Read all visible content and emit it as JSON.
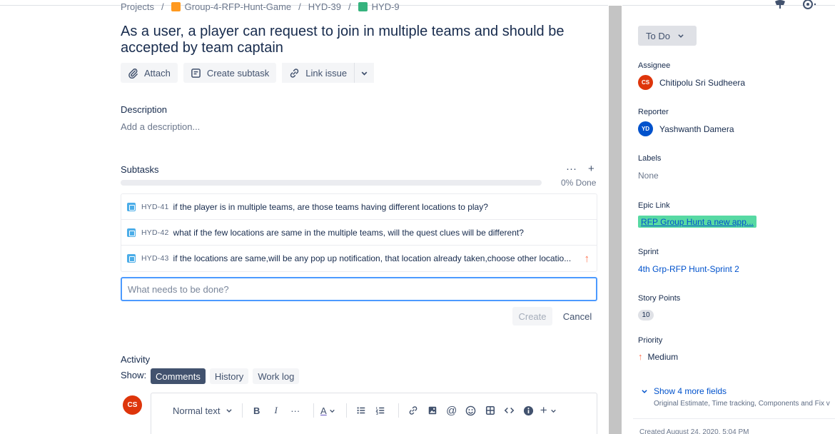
{
  "breadcrumb": {
    "items": [
      "Projects",
      "Group-4-RFP-Hunt-Game",
      "HYD-39",
      "HYD-9"
    ],
    "separator": "/"
  },
  "issue": {
    "title": "As a user, a player can request to join in multiple teams and should be accepted by team captain"
  },
  "toolbar": {
    "attach": "Attach",
    "create_subtask": "Create subtask",
    "link_issue": "Link issue"
  },
  "description": {
    "label": "Description",
    "placeholder": "Add a description..."
  },
  "subtasks": {
    "label": "Subtasks",
    "more": "···",
    "add": "+",
    "progress_text": "0% Done",
    "progress_fraction": 0,
    "items": [
      {
        "key": "HYD-41",
        "summary": "if the player is in multiple teams, are those teams having different locations to play?",
        "priority_icon": ""
      },
      {
        "key": "HYD-42",
        "summary": "what if the few locations are same in the multiple teams, will the quest clues will be different?",
        "priority_icon": ""
      },
      {
        "key": "HYD-43",
        "summary": "if the locations are same,will be any pop up notification, that location already taken,choose other locatio...",
        "priority_icon": "arrow-up-icon"
      }
    ],
    "new_placeholder": "What needs to be done?",
    "create_label": "Create",
    "cancel_label": "Cancel"
  },
  "activity": {
    "label": "Activity",
    "show_label": "Show:",
    "tabs": [
      "Comments",
      "History",
      "Work log"
    ],
    "active_tab": "Comments",
    "commenter_initials": "CS",
    "editor": {
      "text_style": "Normal text",
      "bold": "B",
      "italic": "I",
      "more": "···",
      "text_color": "A",
      "insert": "+"
    }
  },
  "sidebar": {
    "status": "To Do",
    "assignee": {
      "label": "Assignee",
      "initials": "CS",
      "name": "Chitipolu Sri Sudheera"
    },
    "reporter": {
      "label": "Reporter",
      "initials": "YD",
      "name": "Yashwanth Damera"
    },
    "labels": {
      "label": "Labels",
      "value": "None"
    },
    "epic_link": {
      "label": "Epic Link",
      "value": "RFP Group Hunt a new app..."
    },
    "sprint": {
      "label": "Sprint",
      "value": "4th Grp-RFP Hunt-Sprint 2"
    },
    "story_points": {
      "label": "Story Points",
      "value": "10"
    },
    "priority": {
      "label": "Priority",
      "value": "Medium"
    },
    "show_more": "Show 4 more fields",
    "more_fields": "Original Estimate, Time tracking, Components and Fix v",
    "created": "Created August 24, 2020, 5:04 PM"
  },
  "colors": {
    "accent": "#0052cc",
    "epic_bg": "#57d9a3",
    "priority": "#ff7452",
    "assignee_avatar": "#de350b",
    "reporter_avatar": "#0052cc"
  }
}
